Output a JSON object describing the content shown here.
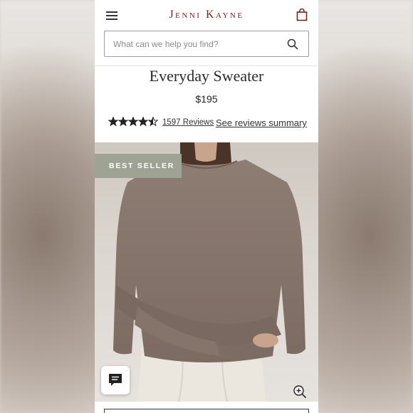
{
  "header": {
    "logo_text": "Jenni Kayne",
    "menu_icon": "hamburger-icon",
    "bag_icon": "shopping-bag-icon"
  },
  "search": {
    "placeholder": "What can we help you find?",
    "icon": "search-icon"
  },
  "product": {
    "title": "Everyday Sweater",
    "price": "$195",
    "rating": 4.5,
    "rating_max": 5,
    "review_count_label": "1597 Reviews",
    "review_summary_label": "See reviews summary",
    "badge": "BEST SELLER"
  },
  "colors": {
    "brand": "#7a1f1f",
    "badge_bg": "#9fa394",
    "sweater": "#8b7a70"
  }
}
